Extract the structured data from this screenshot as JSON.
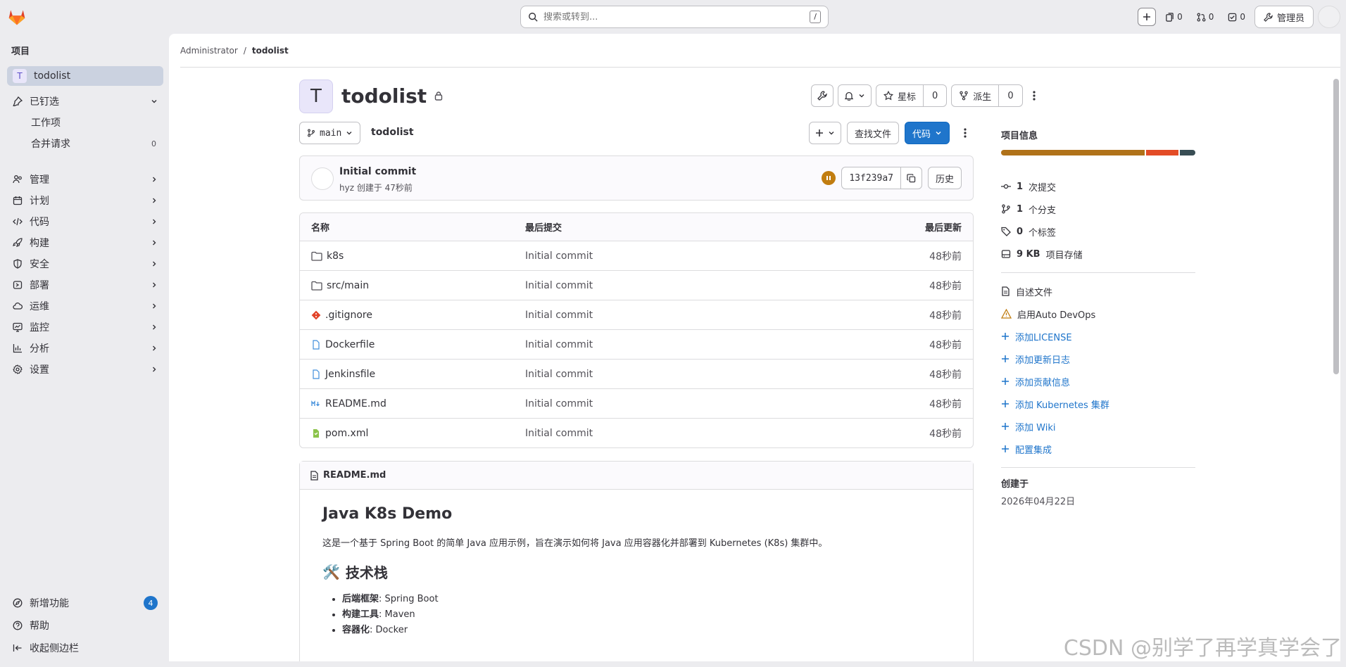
{
  "topbar": {
    "search_placeholder": "搜索或转到...",
    "search_shortcut": "/",
    "issues_count": "0",
    "mr_count": "0",
    "todo_count": "0",
    "admin_label": "管理员"
  },
  "sidebar": {
    "section_title": "项目",
    "project_initial": "T",
    "project_name": "todolist",
    "pinned_label": "已钉选",
    "pinned_items": [
      {
        "label": "工作项",
        "count": ""
      },
      {
        "label": "合并请求",
        "count": "0"
      }
    ],
    "nav": [
      {
        "label": "管理",
        "icon": "manage-icon"
      },
      {
        "label": "计划",
        "icon": "plan-icon"
      },
      {
        "label": "代码",
        "icon": "code-icon"
      },
      {
        "label": "构建",
        "icon": "rocket-icon"
      },
      {
        "label": "安全",
        "icon": "shield-icon"
      },
      {
        "label": "部署",
        "icon": "deploy-icon"
      },
      {
        "label": "运维",
        "icon": "cloud-icon"
      },
      {
        "label": "监控",
        "icon": "monitor-icon"
      },
      {
        "label": "分析",
        "icon": "chart-icon"
      },
      {
        "label": "设置",
        "icon": "gear-icon"
      }
    ],
    "whats_new_label": "新增功能",
    "whats_new_count": "4",
    "help_label": "帮助",
    "collapse_label": "收起侧边栏"
  },
  "breadcrumb": {
    "parent": "Administrator",
    "separator": "/",
    "current": "todolist"
  },
  "project": {
    "initial": "T",
    "title": "todolist",
    "star_label": "星标",
    "star_count": "0",
    "fork_label": "派生",
    "fork_count": "0"
  },
  "repo": {
    "branch": "main",
    "path": "todolist",
    "find_file_label": "查找文件",
    "code_label": "代码"
  },
  "commit": {
    "title": "Initial commit",
    "meta": "hyz 创建于 47秒前",
    "sha": "13f239a7",
    "history_label": "历史"
  },
  "files": {
    "headers": {
      "name": "名称",
      "commit": "最后提交",
      "updated": "最后更新"
    },
    "rows": [
      {
        "name": "k8s",
        "type": "folder",
        "commit": "Initial commit",
        "updated": "48秒前"
      },
      {
        "name": "src/main",
        "type": "folder",
        "commit": "Initial commit",
        "updated": "48秒前"
      },
      {
        "name": ".gitignore",
        "type": "git",
        "commit": "Initial commit",
        "updated": "48秒前"
      },
      {
        "name": "Dockerfile",
        "type": "file",
        "commit": "Initial commit",
        "updated": "48秒前"
      },
      {
        "name": "Jenkinsfile",
        "type": "file",
        "commit": "Initial commit",
        "updated": "48秒前"
      },
      {
        "name": "README.md",
        "type": "markdown",
        "commit": "Initial commit",
        "updated": "48秒前"
      },
      {
        "name": "pom.xml",
        "type": "xml",
        "commit": "Initial commit",
        "updated": "48秒前"
      }
    ]
  },
  "readme": {
    "filename": "README.md",
    "h1": "Java K8s Demo",
    "intro": "这是一个基于 Spring Boot 的简单 Java 应用示例，旨在演示如何将 Java 应用容器化并部署到 Kubernetes (K8s) 集群中。",
    "h2": "技术栈",
    "h2_emoji": "🛠️",
    "list": [
      {
        "key": "后端框架",
        "value": ": Spring Boot"
      },
      {
        "key": "构建工具",
        "value": ": Maven"
      },
      {
        "key": "容器化",
        "value": ": Docker"
      }
    ]
  },
  "info": {
    "title": "项目信息",
    "language_bar": [
      {
        "color": "#b07219",
        "share": 0.75
      },
      {
        "color": "#e34c26",
        "share": 0.17
      },
      {
        "color": "#384d54",
        "share": 0.08
      }
    ],
    "stats": [
      {
        "bold": "1",
        "text": "次提交",
        "icon": "commit-icon"
      },
      {
        "bold": "1",
        "text": "个分支",
        "icon": "branch-icon"
      },
      {
        "bold": "0",
        "text": "个标签",
        "icon": "tag-icon"
      },
      {
        "bold": "9 KB",
        "text": "项目存储",
        "icon": "storage-icon"
      }
    ],
    "readme_link": "自述文件",
    "devops_link": "启用Auto DevOps",
    "add_links": [
      "添加LICENSE",
      "添加更新日志",
      "添加贡献信息",
      "添加 Kubernetes 集群",
      "添加 Wiki",
      "配置集成"
    ],
    "created_label": "创建于",
    "created_value": "2026年04月22日"
  },
  "watermark": "CSDN @别学了再学真学会了"
}
